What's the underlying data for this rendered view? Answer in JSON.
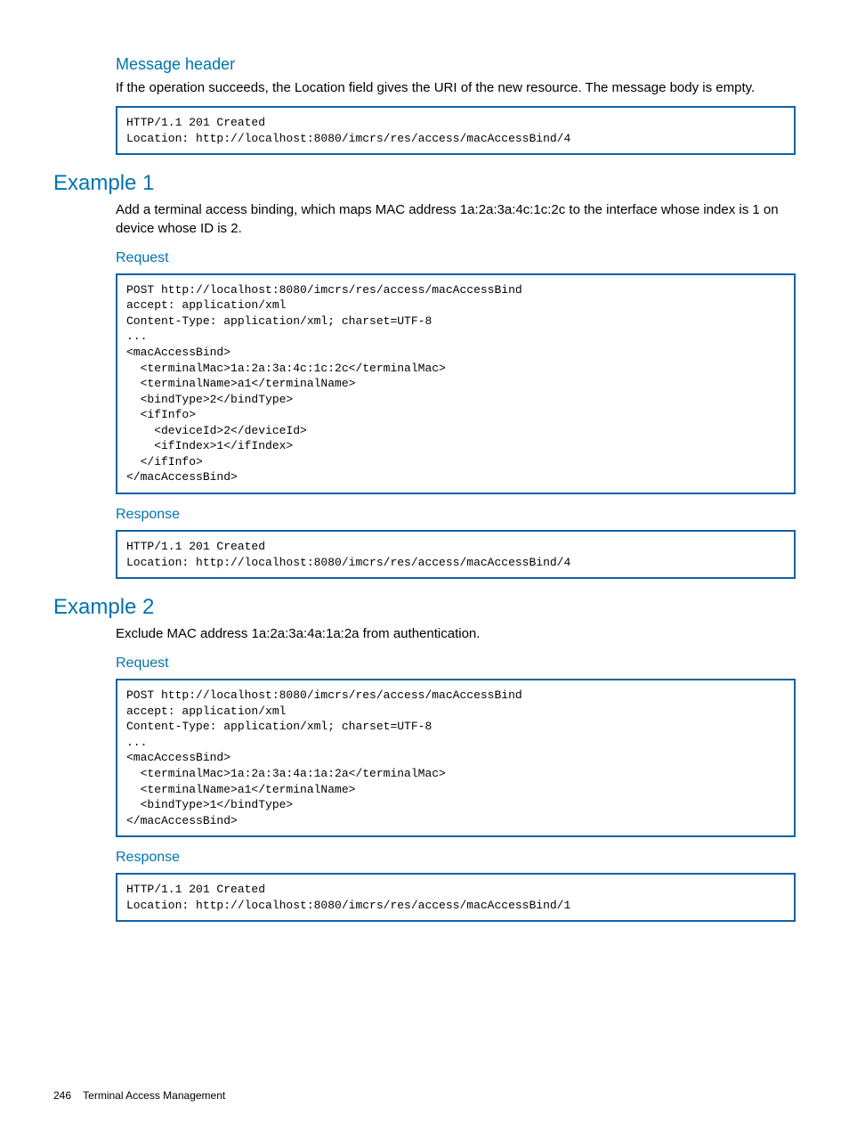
{
  "sections": {
    "message_header": {
      "title": "Message header",
      "body": "If the operation succeeds, the Location field gives the URI of the new resource. The message body is empty.",
      "code": "HTTP/1.1 201 Created\nLocation: http://localhost:8080/imcrs/res/access/macAccessBind/4"
    },
    "example1": {
      "title": "Example 1",
      "body": "Add a terminal access binding, which maps MAC address 1a:2a:3a:4c:1c:2c to the interface whose index is 1 on device whose ID is 2.",
      "request_title": "Request",
      "request_code": "POST http://localhost:8080/imcrs/res/access/macAccessBind\naccept: application/xml\nContent-Type: application/xml; charset=UTF-8\n...\n<macAccessBind>\n  <terminalMac>1a:2a:3a:4c:1c:2c</terminalMac>\n  <terminalName>a1</terminalName>\n  <bindType>2</bindType>\n  <ifInfo>\n    <deviceId>2</deviceId>\n    <ifIndex>1</ifIndex>\n  </ifInfo>\n</macAccessBind>",
      "response_title": "Response",
      "response_code": "HTTP/1.1 201 Created\nLocation: http://localhost:8080/imcrs/res/access/macAccessBind/4"
    },
    "example2": {
      "title": "Example 2",
      "body": "Exclude MAC address 1a:2a:3a:4a:1a:2a from authentication.",
      "request_title": "Request",
      "request_code": "POST http://localhost:8080/imcrs/res/access/macAccessBind\naccept: application/xml\nContent-Type: application/xml; charset=UTF-8\n...\n<macAccessBind>\n  <terminalMac>1a:2a:3a:4a:1a:2a</terminalMac>\n  <terminalName>a1</terminalName>\n  <bindType>1</bindType>\n</macAccessBind>",
      "response_title": "Response",
      "response_code": "HTTP/1.1 201 Created\nLocation: http://localhost:8080/imcrs/res/access/macAccessBind/1"
    }
  },
  "footer": {
    "page_number": "246",
    "section": "Terminal Access Management"
  }
}
